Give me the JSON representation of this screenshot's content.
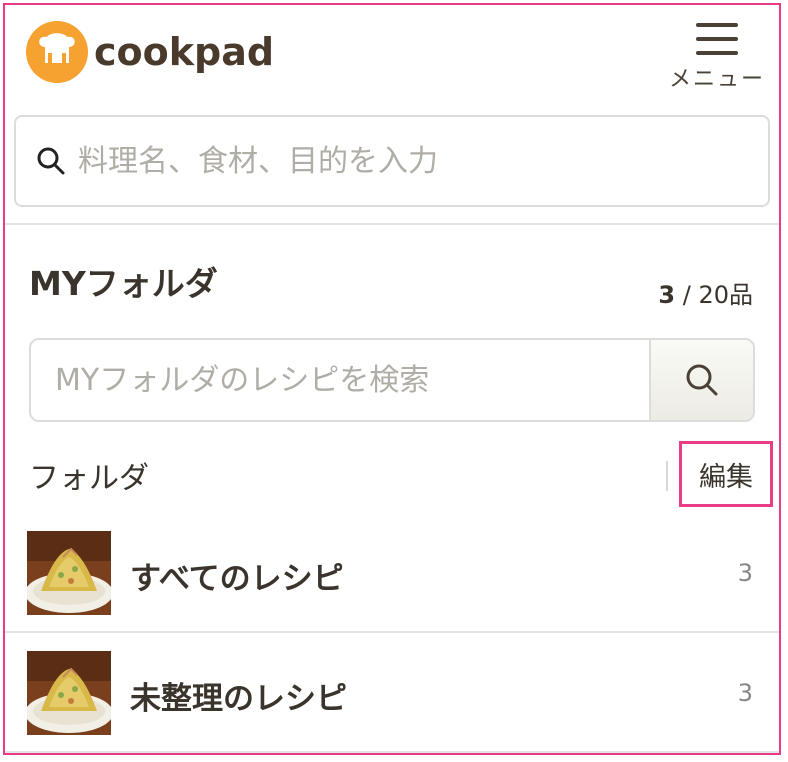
{
  "header": {
    "logo_text": "cookpad",
    "menu_label": "メニュー"
  },
  "search": {
    "placeholder": "料理名、食材、目的を入力"
  },
  "my_folder": {
    "title": "MYフォルダ",
    "count_current": "3",
    "count_total": " / 20品",
    "search_placeholder": "MYフォルダのレシピを検索",
    "folder_label": "フォルダ",
    "edit_label": "編集",
    "folders": [
      {
        "name": "すべてのレシピ",
        "count": "3"
      },
      {
        "name": "未整理のレシピ",
        "count": "3"
      }
    ]
  },
  "colors": {
    "brand_orange": "#f5a230",
    "logo_text": "#4a3a2c",
    "highlight_pink": "#ea3d87"
  },
  "icons": {
    "logo": "chef-hat-icon",
    "menu": "hamburger-menu-icon",
    "search": "search-icon"
  }
}
